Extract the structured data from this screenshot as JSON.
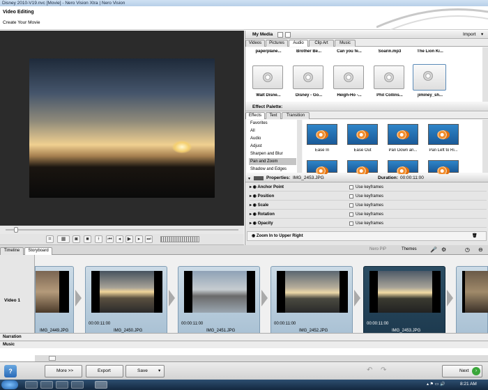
{
  "window": {
    "title": "Disney 2010-V19.nvc [Movie] - Nero Vision Xtra | Nero Vision"
  },
  "header": {
    "title": "Video Editing",
    "subtitle": "Create Your Movie"
  },
  "media": {
    "title": "My Media",
    "import_label": "Import",
    "tabs": [
      "Videos",
      "Pictures",
      "Audio",
      "Clip Art",
      "Music"
    ],
    "active_tab": "Audio",
    "top_row": [
      "paperplane...",
      "Brother Be...",
      "Can you fe...",
      "Soarin.mp3",
      "The Lion Ki..."
    ],
    "items": [
      "Walt Disne...",
      "Disney - Go...",
      "Heigh-Ho -...",
      "Phil Collins...",
      "jiminey_sh..."
    ]
  },
  "effects": {
    "title": "Effect Palette:",
    "tabs": [
      "Effects",
      "Text",
      "Transition"
    ],
    "categories": [
      "Favorites",
      "All",
      "Audio",
      "Adjust",
      "Sharpen and Blur",
      "Pan and Zoom",
      "Shadow and Edges"
    ],
    "selected": "Pan and Zoom",
    "tiles": [
      "Ease In",
      "Ease Out",
      "Pan Down an...",
      "Pan Left to Ri..."
    ]
  },
  "properties": {
    "title": "Properties:",
    "file": "IMG_2453.JPG",
    "duration_label": "Duration:",
    "duration": "00:00:11:00",
    "rows": [
      "Anchor Point",
      "Position",
      "Scale",
      "Rotation",
      "Opacity"
    ],
    "keyframes_label": "Use keyframes",
    "effect_name": "Zoom In to Upper Right"
  },
  "storyboard": {
    "tabs": [
      "Timeline",
      "Storyboard"
    ],
    "active_tab": "Storyboard",
    "tools": [
      "Nero PiP",
      "Themes"
    ],
    "track_video": "Video 1",
    "track_narration": "Narration",
    "track_music": "Music",
    "clips": [
      {
        "name": "IMG_2449.JPG",
        "duration": ""
      },
      {
        "name": "IMG_2450.JPG",
        "duration": "00:00:11:00"
      },
      {
        "name": "IMG_2451.JPG",
        "duration": "00:00:11:00"
      },
      {
        "name": "IMG_2452.JPG",
        "duration": "00:00:11:00"
      },
      {
        "name": "IMG_2453.JPG",
        "duration": "00:00:11:00"
      }
    ]
  },
  "footer": {
    "more": "More >>",
    "export": "Export",
    "save": "Save",
    "next": "Next"
  },
  "taskbar": {
    "time": "8:21 AM"
  }
}
